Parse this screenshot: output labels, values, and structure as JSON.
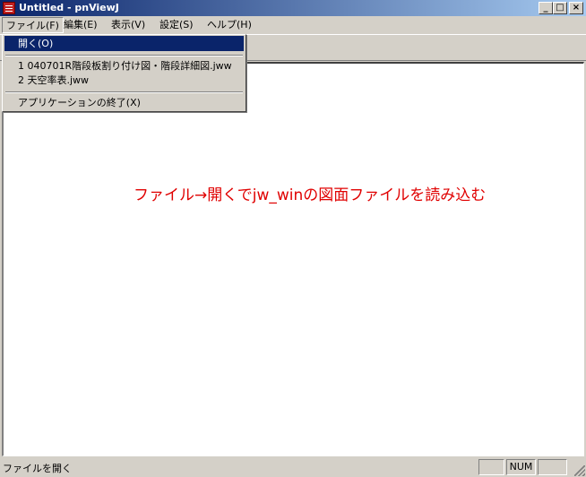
{
  "window": {
    "title": "Untitled - pnViewJ",
    "minimize_glyph": "_",
    "maximize_glyph": "□",
    "close_glyph": "×"
  },
  "menubar": {
    "items": [
      {
        "label": "ファイル(F)"
      },
      {
        "label": "編集(E)"
      },
      {
        "label": "表示(V)"
      },
      {
        "label": "設定(S)"
      },
      {
        "label": "ヘルプ(H)"
      }
    ]
  },
  "file_menu": {
    "open": "開く(O)",
    "recent": [
      {
        "label": "1 040701R階段板割り付け図・階段詳細図.jww"
      },
      {
        "label": "2 天空率表.jww"
      }
    ],
    "exit": "アプリケーションの終了(X)"
  },
  "annotation": {
    "text": "ファイル→開くでjw_winの図面ファイルを読み込む",
    "color": "#e00000"
  },
  "statusbar": {
    "text": "ファイルを開く",
    "num_indicator": "NUM"
  },
  "colors": {
    "titlebar_start": "#0a246a",
    "titlebar_end": "#a6caf0",
    "menu_highlight": "#0a246a",
    "face": "#d4d0c8"
  }
}
